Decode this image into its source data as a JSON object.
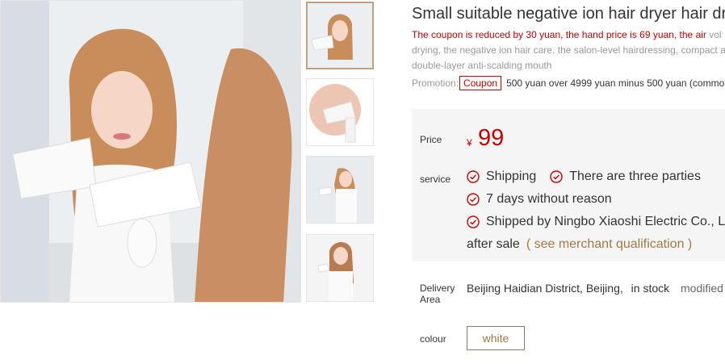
{
  "product": {
    "title": "Small suitable negative ion hair dryer hair dr",
    "subtitle_red": "The coupon is reduced by 30 yuan, the hand price is 69 yuan, the air",
    "subtitle_tail": " vol",
    "subtitle_line2": "drying, the negative ion hair care, the salon-level hairdressing, compact a",
    "subtitle_line3": "double-layer anti-scalding mouth"
  },
  "promotion": {
    "label": "Promotion:",
    "coupon": "Coupon",
    "text": "500 yuan over 4999 yuan minus 500 yuan (commo"
  },
  "price": {
    "label": "Price",
    "currency": "¥",
    "value": "99"
  },
  "service": {
    "label": "service",
    "items": [
      "Shipping",
      "There are three parties",
      "7 days without reason",
      "Shipped by Ningbo Xiaoshi Electric Co., L"
    ],
    "after_sale": "after sale",
    "qualification_link": "( see merchant qualification )"
  },
  "delivery": {
    "label": "Delivery Area",
    "location": "Beijing Haidian District, Beijing,",
    "stock": "in stock",
    "modified": "modified"
  },
  "colour": {
    "label": "colour",
    "selected": "white"
  },
  "colors": {
    "accent_red": "#c40000",
    "link_gold": "#a07a45"
  }
}
